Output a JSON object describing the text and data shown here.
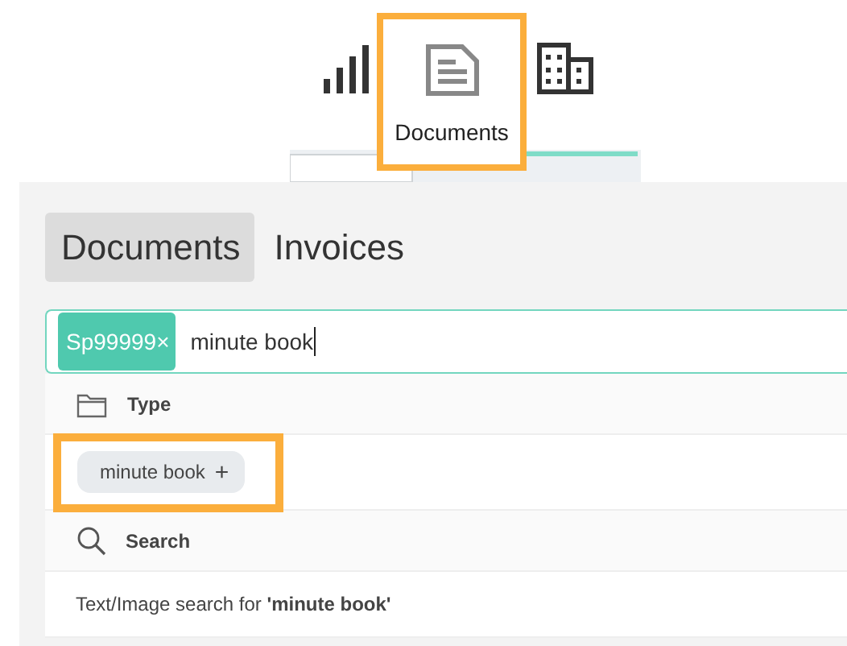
{
  "nav": [
    {
      "kind": "chart",
      "highlighted": false
    },
    {
      "kind": "document",
      "label": "Documents",
      "highlighted": true
    },
    {
      "kind": "building",
      "highlighted": false
    }
  ],
  "tabs": [
    {
      "label": "Documents",
      "selected": true
    },
    {
      "label": "Invoices",
      "selected": false
    }
  ],
  "search": {
    "tokens": [
      {
        "label": "Sp99999",
        "remove": "×"
      }
    ],
    "value": "minute book"
  },
  "dropdown": [
    {
      "kind": "folder",
      "heading": "Type",
      "options": [
        {
          "kind": "chip",
          "label": "minute book",
          "add": "+",
          "highlighted": true
        }
      ]
    },
    {
      "kind": "search",
      "heading": "Search",
      "options": [
        {
          "kind": "text",
          "label": "Text/Image search for **'minute book'**",
          "highlighted": false
        }
      ]
    }
  ]
}
